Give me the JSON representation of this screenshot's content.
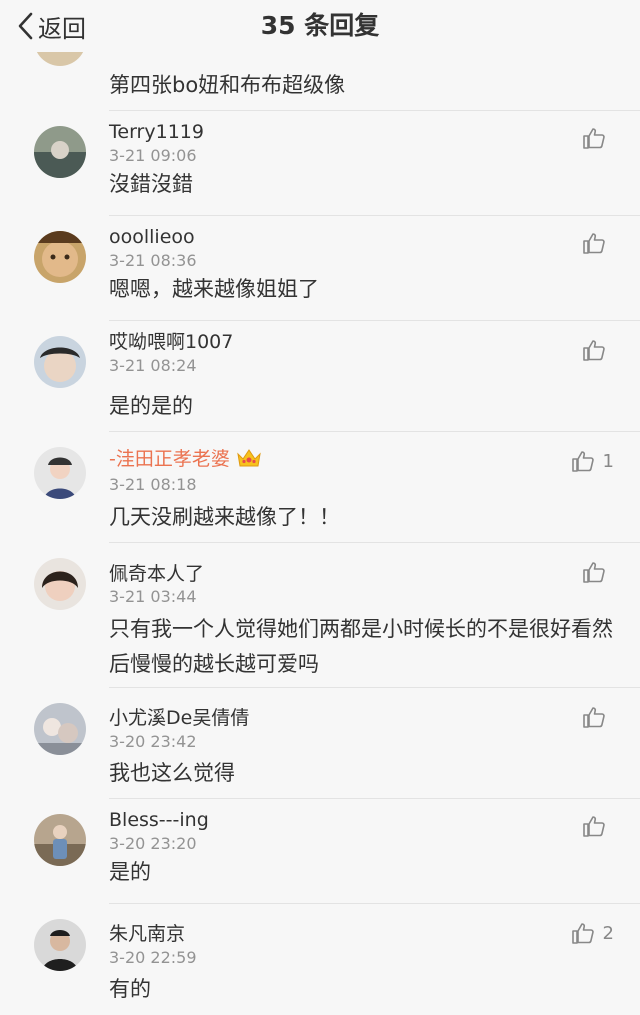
{
  "nav": {
    "back_label": "返回",
    "title": "35 条回复"
  },
  "partial_text": "第四张bo妞和布布超级像",
  "comments": [
    {
      "name": "Terry1119",
      "time": "3-21 09:06",
      "text": "沒錯沒錯",
      "likes": "",
      "vip": false
    },
    {
      "name": "ooollieoo",
      "time": "3-21 08:36",
      "text": "嗯嗯，越来越像姐姐了",
      "likes": "",
      "vip": false
    },
    {
      "name": "哎呦喂啊1007",
      "time": "3-21 08:24",
      "text": "是的是的",
      "likes": "",
      "vip": false
    },
    {
      "name": "-洼田正孝老婆",
      "time": "3-21 08:18",
      "text": "几天没刷越来越像了！！",
      "likes": "1",
      "vip": true
    },
    {
      "name": "佩奇本人了",
      "time": "3-21 03:44",
      "text": "只有我一个人觉得她们两都是小时候长的不是很好看然后慢慢的越长越可爱吗",
      "likes": "",
      "vip": false
    },
    {
      "name": "小尤溪De吴倩倩",
      "time": "3-20 23:42",
      "text": "我也这么觉得",
      "likes": "",
      "vip": false
    },
    {
      "name": "Bless---ing",
      "time": "3-20 23:20",
      "text": "是的",
      "likes": "",
      "vip": false
    },
    {
      "name": "朱凡南京",
      "time": "3-20 22:59",
      "text": "有的",
      "likes": "2",
      "vip": false
    }
  ],
  "icons": {
    "back": "chevron-left-icon",
    "like": "thumbs-up-icon",
    "vip": "crown-icon"
  },
  "colors": {
    "vip_name": "#eb7350",
    "time": "#939393",
    "text": "#333333",
    "background": "#f7f7f7"
  }
}
